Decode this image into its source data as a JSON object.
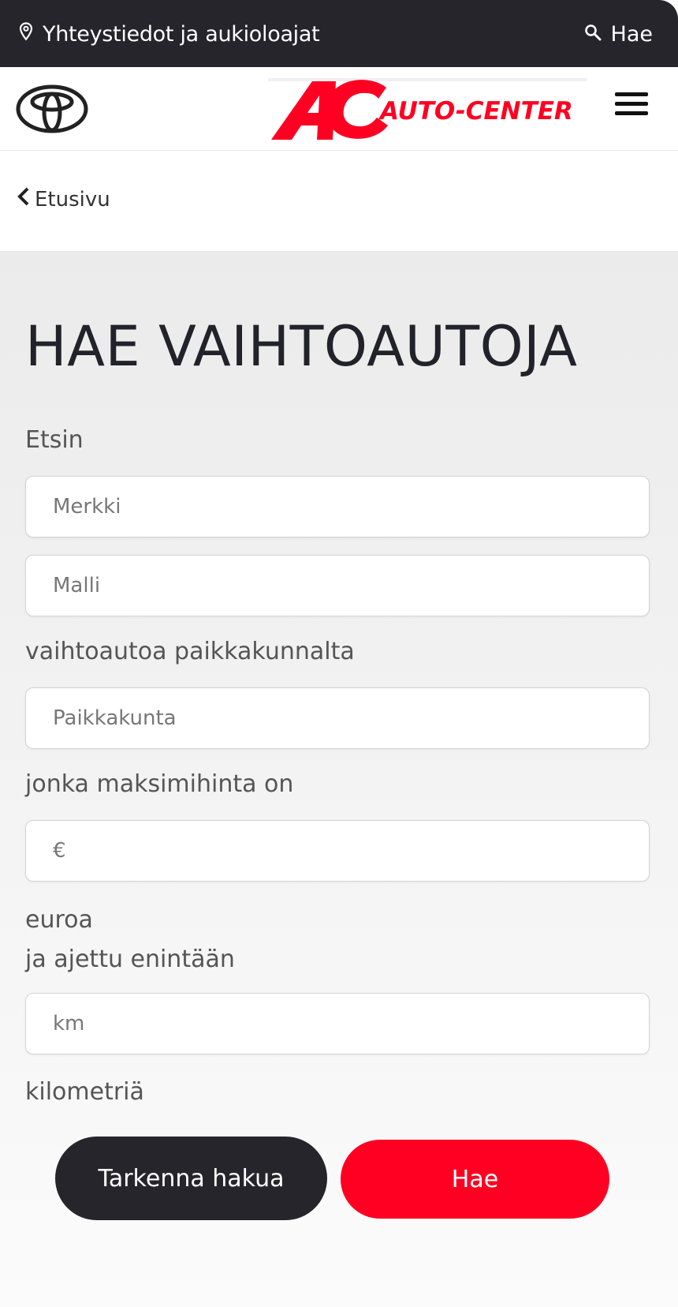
{
  "topbar": {
    "contact_label": "Yhteystiedot ja aukioloajat",
    "contact_icon": "location-pin-icon",
    "search_label": "Hae",
    "search_icon": "search-icon"
  },
  "header": {
    "toyota_logo": "toyota-logo",
    "dealer_logo_letters": "AC",
    "dealer_logo_text": "Auto-Center",
    "menu_icon": "hamburger-icon"
  },
  "breadcrumb": {
    "label": "Etusivu",
    "icon": "chevron-left-icon"
  },
  "form": {
    "title": "HAE VAIHTOAUTOJA",
    "intro_label": "Etsin",
    "make_placeholder": "Merkki",
    "model_placeholder": "Malli",
    "location_label": "vaihtoautoa paikkakunnalta",
    "location_placeholder": "Paikkakunta",
    "price_label": "jonka maksimihinta on",
    "price_placeholder": "€",
    "price_suffix": "euroa",
    "mileage_label": "ja ajettu enintään",
    "mileage_placeholder": "km",
    "mileage_suffix": "kilometriä",
    "refine_button": "Tarkenna hakua",
    "search_button": "Hae"
  },
  "colors": {
    "topbar_bg": "#25252b",
    "accent_red": "#ff0022",
    "dark_button": "#25252b"
  }
}
